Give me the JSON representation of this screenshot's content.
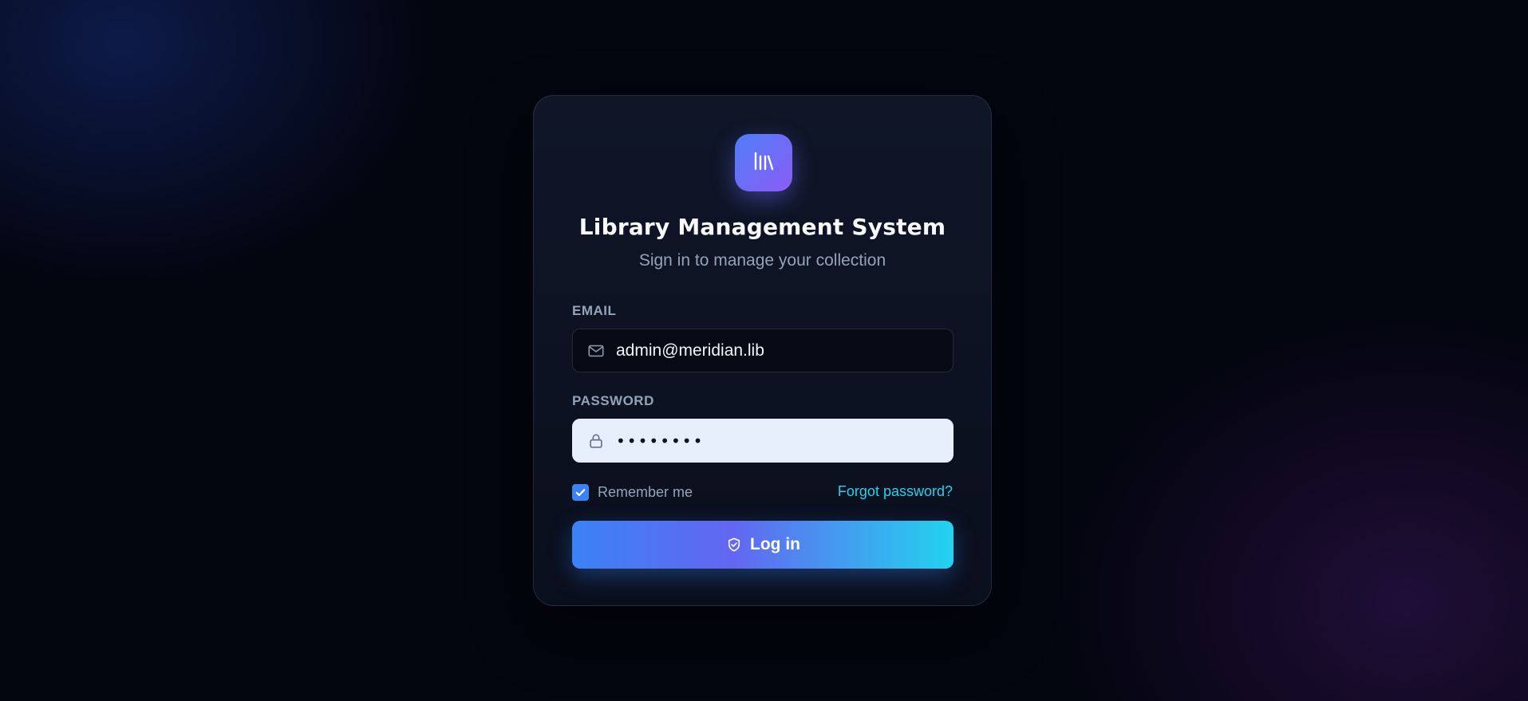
{
  "app": {
    "title": "Library Management System",
    "subtitle": "Sign in to manage your collection",
    "logo_icon": "library-books-icon"
  },
  "form": {
    "email": {
      "label": "EMAIL",
      "value": "admin@meridian.lib",
      "icon": "mail-icon"
    },
    "password": {
      "label": "PASSWORD",
      "value": "••••••••",
      "icon": "lock-icon"
    },
    "remember": {
      "label": "Remember me",
      "checked": true
    },
    "forgot_label": "Forgot password?",
    "login": {
      "label": "Log in",
      "icon": "shield-check-icon"
    }
  },
  "colors": {
    "background": "#03050f",
    "accent_blue": "#3b82f6",
    "accent_violet": "#8b5cf6",
    "accent_cyan": "#22d3ee",
    "muted_text": "#94a3b8"
  }
}
